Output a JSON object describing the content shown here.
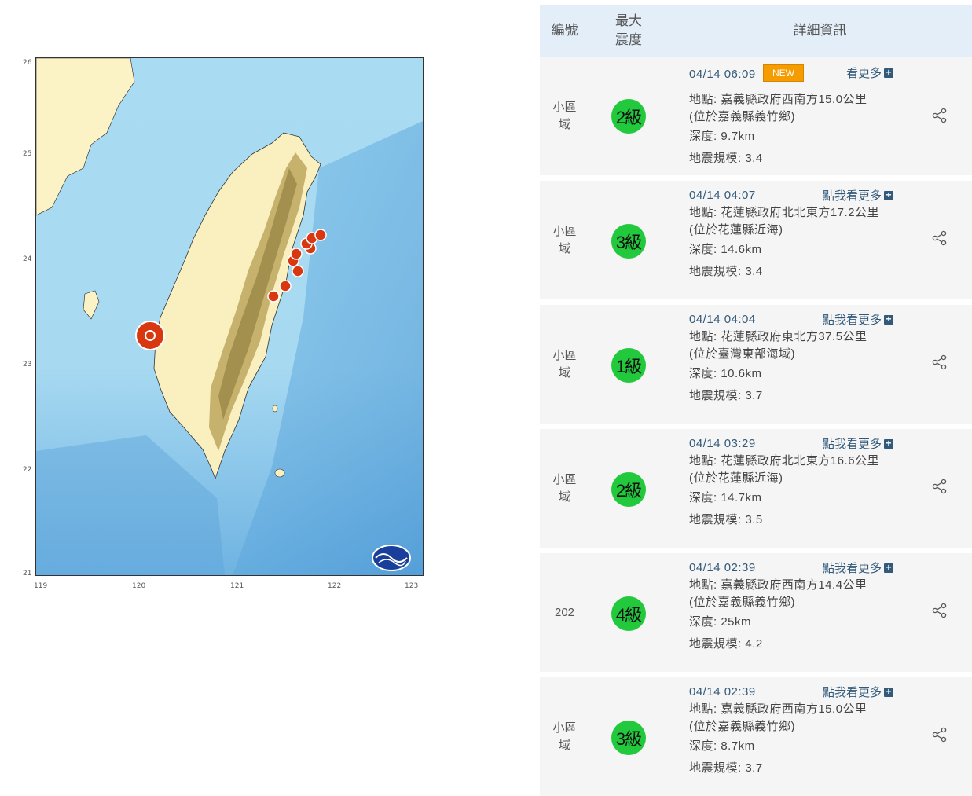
{
  "map": {
    "y_ticks": [
      "26",
      "25",
      "24",
      "23",
      "22",
      "21"
    ],
    "x_ticks": [
      "119",
      "120",
      "121",
      "122",
      "123"
    ]
  },
  "table": {
    "headers": {
      "no": "編號",
      "max_intensity": "最大\n震度",
      "details": "詳細資訊"
    },
    "rows": [
      {
        "area": "小區域",
        "intensity": "2級",
        "time": "04/14 06:09",
        "new": "NEW",
        "more": "看更多",
        "location": "地點: 嘉義縣政府西南方15.0公里",
        "sub": "(位於嘉義縣義竹鄉)",
        "depth": "深度: 9.7km",
        "magnitude": "地震規模: 3.4"
      },
      {
        "area": "小區域",
        "intensity": "3級",
        "time": "04/14 04:07",
        "more": "點我看更多",
        "location": "地點: 花蓮縣政府北北東方17.2公里",
        "sub": "(位於花蓮縣近海)",
        "depth": "深度: 14.6km",
        "magnitude": "地震規模: 3.4"
      },
      {
        "area": "小區域",
        "intensity": "1級",
        "time": "04/14 04:04",
        "more": "點我看更多",
        "location": "地點: 花蓮縣政府東北方37.5公里",
        "sub": "(位於臺灣東部海域)",
        "depth": "深度: 10.6km",
        "magnitude": "地震規模: 3.7"
      },
      {
        "area": "小區域",
        "intensity": "2級",
        "time": "04/14 03:29",
        "more": "點我看更多",
        "location": "地點: 花蓮縣政府北北東方16.6公里",
        "sub": "(位於花蓮縣近海)",
        "depth": "深度: 14.7km",
        "magnitude": "地震規模: 3.5"
      },
      {
        "area": "202",
        "intensity": "4級",
        "time": "04/14 02:39",
        "more": "點我看更多",
        "location": "地點: 嘉義縣政府西南方14.4公里",
        "sub": "(位於嘉義縣義竹鄉)",
        "depth": "深度: 25km",
        "magnitude": "地震規模: 4.2"
      },
      {
        "area": "小區域",
        "intensity": "3級",
        "time": "04/14 02:39",
        "more": "點我看更多",
        "location": "地點: 嘉義縣政府西南方15.0公里",
        "sub": "(位於嘉義縣義竹鄉)",
        "depth": "深度: 8.7km",
        "magnitude": "地震規模: 3.7"
      }
    ]
  },
  "colors": {
    "intensity_badge": "#22c93c",
    "new_badge": "#f59c00",
    "header_bg": "#e4eef9",
    "epicenter": "#d8370f"
  }
}
